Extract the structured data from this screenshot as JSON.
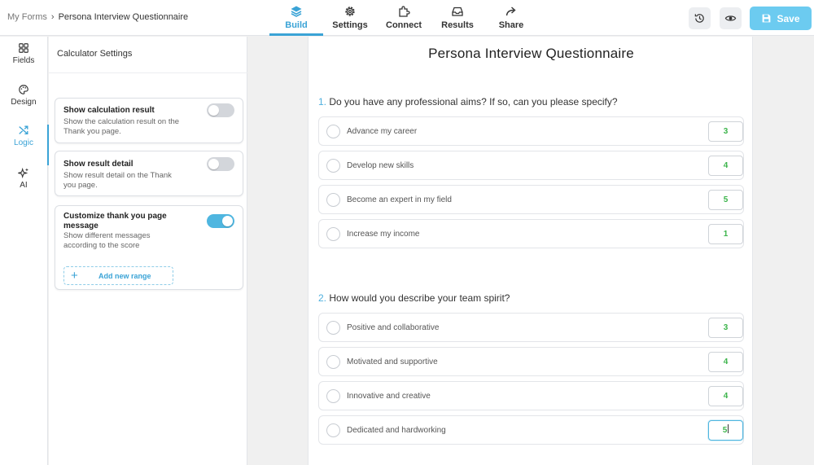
{
  "breadcrumb": {
    "root": "My Forms",
    "separator": "›",
    "current": "Persona Interview Questionnaire"
  },
  "nav_tabs": [
    {
      "label": "Build",
      "icon": "layers-icon",
      "active": true
    },
    {
      "label": "Settings",
      "icon": "gear-icon",
      "active": false
    },
    {
      "label": "Connect",
      "icon": "puzzle-icon",
      "active": false
    },
    {
      "label": "Results",
      "icon": "inbox-icon",
      "active": false
    },
    {
      "label": "Share",
      "icon": "share-arrow-icon",
      "active": false
    }
  ],
  "toolbar": {
    "history_icon": "history-icon",
    "preview_icon": "eye-icon",
    "save_label": "Save",
    "save_icon": "floppy-disk-icon"
  },
  "rail": {
    "items": [
      {
        "label": "Fields",
        "icon": "grid-icon",
        "active": false
      },
      {
        "label": "Design",
        "icon": "palette-icon",
        "active": false
      },
      {
        "label": "Logic",
        "icon": "shuffle-icon",
        "active": true
      },
      {
        "label": "AI",
        "icon": "sparkle-icon",
        "active": false
      }
    ]
  },
  "panel": {
    "title": "Calculator Settings",
    "cards": [
      {
        "title": "Show calculation result",
        "description_lines": [
          "Show the calculation result on the",
          "Thank you page."
        ],
        "enabled": false
      },
      {
        "title": "Show result detail",
        "description_lines": [
          "Show result detail on the Thank",
          "you page."
        ],
        "enabled": false
      },
      {
        "title_lines": [
          "Customize thank you page",
          "message"
        ],
        "description_lines": [
          "Show different messages",
          "according to the score"
        ],
        "enabled": true,
        "add_range_label": "Add new range"
      }
    ]
  },
  "form": {
    "title": "Persona Interview Questionnaire",
    "questions": [
      {
        "number": "1.",
        "text": "Do you have any professional aims? If so, can you please specify?",
        "options": [
          {
            "label": "Advance my career",
            "score": "3"
          },
          {
            "label": "Develop new skills",
            "score": "4"
          },
          {
            "label": "Become an expert in my field",
            "score": "5"
          },
          {
            "label": "Increase my income",
            "score": "1"
          }
        ]
      },
      {
        "number": "2.",
        "text": "How would you describe your team spirit?",
        "options": [
          {
            "label": "Positive and collaborative",
            "score": "3"
          },
          {
            "label": "Motivated and supportive",
            "score": "4"
          },
          {
            "label": "Innovative and creative",
            "score": "4"
          },
          {
            "label": "Dedicated and hardworking",
            "score": "5"
          }
        ]
      }
    ]
  },
  "colors": {
    "accent": "#3aa3d6",
    "save_button": "#6ccbf0",
    "score_text": "#3cb44b",
    "toggle_on": "#4fb6e0",
    "toggle_off": "#d3d6db"
  }
}
